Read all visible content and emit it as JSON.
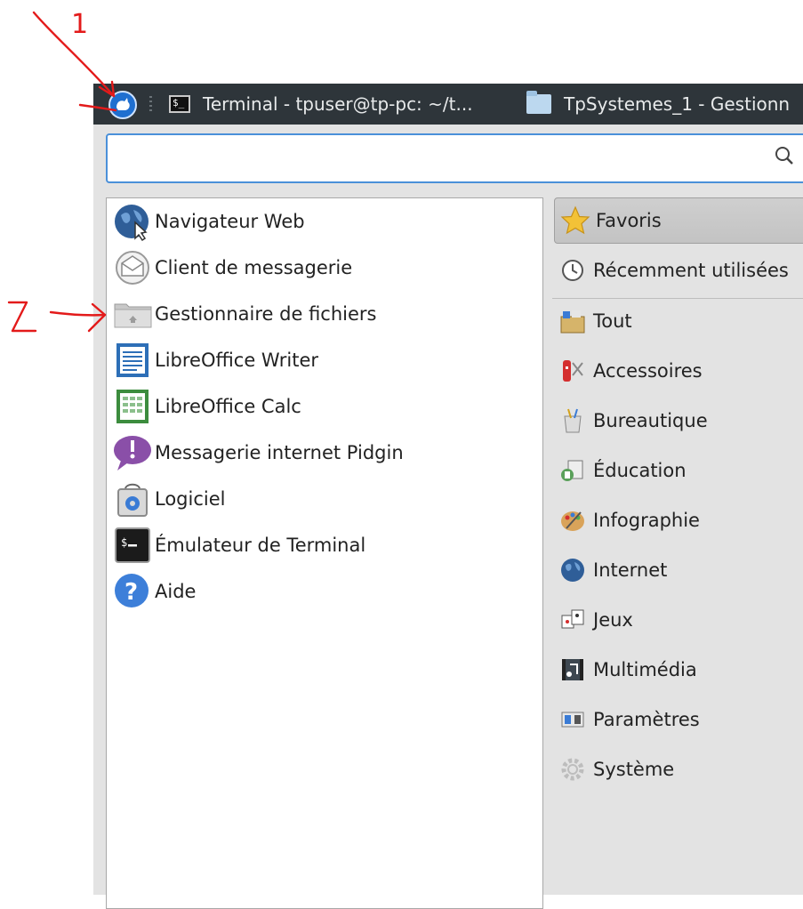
{
  "annotations": {
    "marker_1": "1",
    "marker_2": "2"
  },
  "taskbar": {
    "menu_button_icon": "whisker-mouse-icon",
    "tasks": [
      {
        "label": "Terminal - tpuser@tp-pc: ~/t...",
        "icon": "terminal-icon"
      },
      {
        "label": "TpSystemes_1 - Gestionn",
        "icon": "folder-icon"
      }
    ]
  },
  "search": {
    "value": "",
    "placeholder": "",
    "icon": "search-icon"
  },
  "favorites": [
    {
      "label": "Navigateur Web",
      "icon": "web-browser-icon"
    },
    {
      "label": "Client de messagerie",
      "icon": "mail-client-icon"
    },
    {
      "label": "Gestionnaire de fichiers",
      "icon": "file-manager-icon"
    },
    {
      "label": "LibreOffice Writer",
      "icon": "writer-icon"
    },
    {
      "label": "LibreOffice Calc",
      "icon": "calc-icon"
    },
    {
      "label": "Messagerie internet Pidgin",
      "icon": "pidgin-icon"
    },
    {
      "label": "Logiciel",
      "icon": "software-icon"
    },
    {
      "label": "Émulateur de Terminal",
      "icon": "terminal-icon"
    },
    {
      "label": "Aide",
      "icon": "help-icon"
    }
  ],
  "categories": [
    {
      "label": "Favoris",
      "icon": "star-icon",
      "active": true
    },
    {
      "label": "Récemment utilisées",
      "icon": "clock-icon"
    },
    {
      "label": "Tout",
      "icon": "all-apps-icon"
    },
    {
      "label": "Accessoires",
      "icon": "accessories-icon"
    },
    {
      "label": "Bureautique",
      "icon": "office-icon"
    },
    {
      "label": "Éducation",
      "icon": "education-icon"
    },
    {
      "label": "Infographie",
      "icon": "graphics-icon"
    },
    {
      "label": "Internet",
      "icon": "internet-icon"
    },
    {
      "label": "Jeux",
      "icon": "games-icon"
    },
    {
      "label": "Multimédia",
      "icon": "multimedia-icon"
    },
    {
      "label": "Paramètres",
      "icon": "settings-icon"
    },
    {
      "label": "Système",
      "icon": "system-icon"
    }
  ],
  "colors": {
    "taskbar": "#2e353a",
    "menu_bg": "#e3e3e3",
    "search_border": "#4a90d9",
    "annotation": "#e31a1a"
  }
}
